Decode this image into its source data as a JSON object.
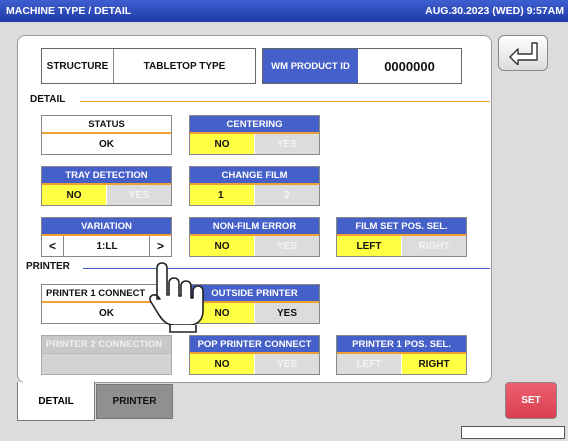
{
  "titlebar": {
    "title": "MACHINE TYPE / DETAIL",
    "datetime": "AUG.30.2023 (WED)  9:57AM"
  },
  "structure": {
    "label": "STRUCTURE",
    "value": "TABLETOP TYPE"
  },
  "wm_product_id": {
    "label": "WM PRODUCT ID",
    "value": "0000000"
  },
  "sections": {
    "detail": "DETAIL",
    "printer": "PRINTER"
  },
  "status": {
    "label": "STATUS",
    "value": "OK"
  },
  "centering": {
    "label": "CENTERING",
    "options": [
      "NO",
      "YES"
    ],
    "selected": "NO"
  },
  "tray_detection": {
    "label": "TRAY DETECTION",
    "options": [
      "NO",
      "YES"
    ],
    "selected": "NO"
  },
  "change_film": {
    "label": "CHANGE FILM",
    "options": [
      "1",
      "2"
    ],
    "selected": "1"
  },
  "variation": {
    "label": "VARIATION",
    "value": "1:LL",
    "prev": "<",
    "next": ">"
  },
  "non_film_error": {
    "label": "NON-FILM ERROR",
    "options": [
      "NO",
      "YES"
    ],
    "selected": "NO"
  },
  "film_set_pos": {
    "label": "FILM SET POS. SEL.",
    "options": [
      "LEFT",
      "RIGHT"
    ],
    "selected": "LEFT"
  },
  "printer1_connect": {
    "label": "PRINTER 1 CONNECT",
    "value": "OK"
  },
  "outside_printer": {
    "label": "OUTSIDE PRINTER",
    "options": [
      "NO",
      "YES"
    ],
    "selected": "NO"
  },
  "printer2_connect": {
    "label": "PRINTER 2 CONNECTION"
  },
  "pop_printer_connect": {
    "label": "POP PRINTER CONNECT",
    "options": [
      "NO",
      "YES"
    ],
    "selected": "NO"
  },
  "printer1_pos": {
    "label": "PRINTER 1 POS. SEL.",
    "options": [
      "LEFT",
      "RIGHT"
    ],
    "selected": "RIGHT"
  },
  "tabs": [
    "DETAIL",
    "PRINTER"
  ],
  "set_button": "SET",
  "icons": {
    "back": "return-arrow-icon",
    "hand": "pointing-hand-icon"
  },
  "colors": {
    "titlebar": "#2b46b8",
    "header_blue": "#4560c8",
    "selected": "#ffff44",
    "set": "#e05060",
    "accent_line": "#f0a030"
  }
}
